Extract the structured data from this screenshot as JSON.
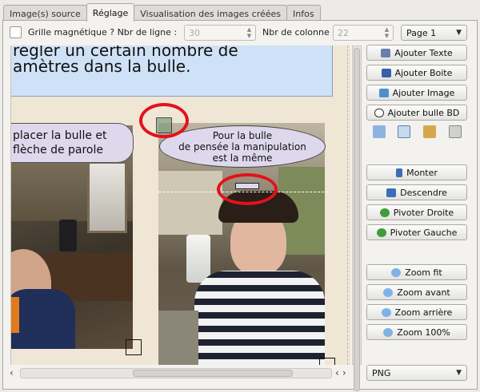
{
  "tabs": [
    {
      "label": "Image(s) source",
      "active": false
    },
    {
      "label": "Réglage",
      "active": true
    },
    {
      "label": "Visualisation des images créées",
      "active": false
    },
    {
      "label": "Infos",
      "active": false
    }
  ],
  "controls": {
    "grid_label": "Grille magnétique ? Nbr de ligne :",
    "lines_value": "30",
    "columns_label": "Nbr de colonne :",
    "columns_value": "22",
    "page_select": "Page 1",
    "format_select": "PNG"
  },
  "canvas": {
    "top_bubble_line1": "régler un certain nombre de",
    "top_bubble_line2": "amètres dans la bulle.",
    "left_bubble_line1": "placer la bulle et",
    "left_bubble_line2": "flèche de parole",
    "right_bubble_line1": "Pour la bulle",
    "right_bubble_line2": "de pensée la manipulation",
    "right_bubble_line3": "est la même"
  },
  "buttons": {
    "add_text": "Ajouter Texte",
    "add_box": "Ajouter Boite",
    "add_image": "Ajouter Image",
    "add_bubble": "Ajouter bulle BD",
    "raise": "Monter",
    "lower": "Descendre",
    "rotate_right": "Pivoter Droite",
    "rotate_left": "Pivoter Gauche",
    "zoom_fit": "Zoom fit",
    "zoom_in": "Zoom avant",
    "zoom_out": "Zoom arrière",
    "zoom_100": "Zoom 100%"
  },
  "icons": {
    "copy": "copy-icon",
    "cut": "cut-icon",
    "paste": "paste-icon",
    "delete": "delete-icon"
  },
  "colors": {
    "highlight_red": "#e3121a",
    "bubble_fill": "#ddd8ec",
    "top_bubble_fill": "#cfe1f6"
  }
}
